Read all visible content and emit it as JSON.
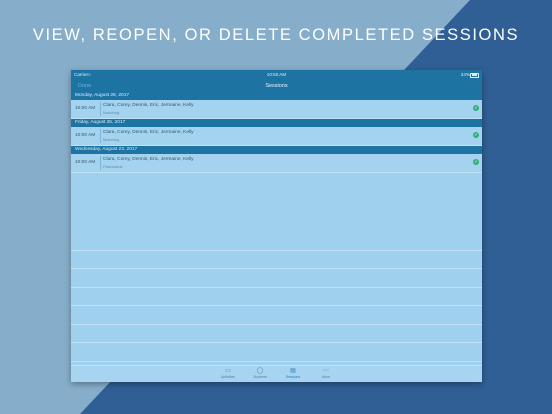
{
  "banner": {
    "text": "VIEW, REOPEN, OR DELETE COMPLETED SESSIONS"
  },
  "status_bar": {
    "carrier": "Carrier",
    "wifi_icon": "wifi-icon",
    "time": "10:50 AM",
    "battery": "34%",
    "battery_icon": "battery-icon"
  },
  "nav": {
    "left": "Done",
    "title": "Sessions"
  },
  "sections": [
    {
      "date": "Monday, August 28, 2017",
      "rows": [
        {
          "time": "10:00 AM",
          "names": "Clara, Corey, Dennis, Eric, Jermaine, Kelly",
          "type": "Matching"
        }
      ]
    },
    {
      "date": "Friday, August 25, 2017",
      "rows": [
        {
          "time": "10:00 AM",
          "names": "Clara, Corey, Dennis, Eric, Jermaine, Kelly",
          "type": "Matching"
        }
      ]
    },
    {
      "date": "Wednesday, August 23, 2017",
      "rows": [
        {
          "time": "10:00 AM",
          "names": "Clara, Corey, Dennis, Eric, Jermaine, Kelly",
          "type": "Flashcards"
        }
      ]
    }
  ],
  "tabs": [
    {
      "label": "Activities",
      "icon": "activities-icon"
    },
    {
      "label": "Students",
      "icon": "students-icon"
    },
    {
      "label": "Sessions",
      "icon": "sessions-icon"
    },
    {
      "label": "More",
      "icon": "more-icon"
    }
  ],
  "colors": {
    "bar": "#1d74a3",
    "row": "#a4d3f0",
    "check": "#2fae7a",
    "bg_right": "#2f5f94",
    "bg_left": "#86aeca"
  }
}
